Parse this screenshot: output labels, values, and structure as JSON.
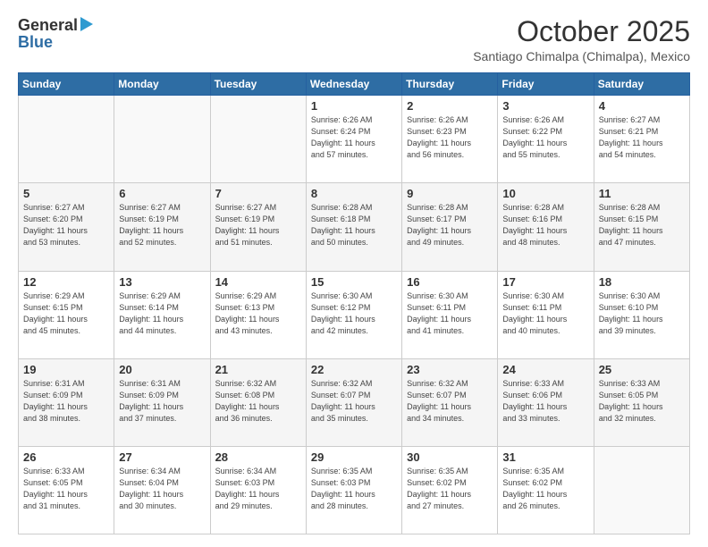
{
  "header": {
    "logo_general": "General",
    "logo_blue": "Blue",
    "month": "October 2025",
    "location": "Santiago Chimalpa (Chimalpa), Mexico"
  },
  "weekdays": [
    "Sunday",
    "Monday",
    "Tuesday",
    "Wednesday",
    "Thursday",
    "Friday",
    "Saturday"
  ],
  "weeks": [
    [
      {
        "day": "",
        "info": ""
      },
      {
        "day": "",
        "info": ""
      },
      {
        "day": "",
        "info": ""
      },
      {
        "day": "1",
        "info": "Sunrise: 6:26 AM\nSunset: 6:24 PM\nDaylight: 11 hours\nand 57 minutes."
      },
      {
        "day": "2",
        "info": "Sunrise: 6:26 AM\nSunset: 6:23 PM\nDaylight: 11 hours\nand 56 minutes."
      },
      {
        "day": "3",
        "info": "Sunrise: 6:26 AM\nSunset: 6:22 PM\nDaylight: 11 hours\nand 55 minutes."
      },
      {
        "day": "4",
        "info": "Sunrise: 6:27 AM\nSunset: 6:21 PM\nDaylight: 11 hours\nand 54 minutes."
      }
    ],
    [
      {
        "day": "5",
        "info": "Sunrise: 6:27 AM\nSunset: 6:20 PM\nDaylight: 11 hours\nand 53 minutes."
      },
      {
        "day": "6",
        "info": "Sunrise: 6:27 AM\nSunset: 6:19 PM\nDaylight: 11 hours\nand 52 minutes."
      },
      {
        "day": "7",
        "info": "Sunrise: 6:27 AM\nSunset: 6:19 PM\nDaylight: 11 hours\nand 51 minutes."
      },
      {
        "day": "8",
        "info": "Sunrise: 6:28 AM\nSunset: 6:18 PM\nDaylight: 11 hours\nand 50 minutes."
      },
      {
        "day": "9",
        "info": "Sunrise: 6:28 AM\nSunset: 6:17 PM\nDaylight: 11 hours\nand 49 minutes."
      },
      {
        "day": "10",
        "info": "Sunrise: 6:28 AM\nSunset: 6:16 PM\nDaylight: 11 hours\nand 48 minutes."
      },
      {
        "day": "11",
        "info": "Sunrise: 6:28 AM\nSunset: 6:15 PM\nDaylight: 11 hours\nand 47 minutes."
      }
    ],
    [
      {
        "day": "12",
        "info": "Sunrise: 6:29 AM\nSunset: 6:15 PM\nDaylight: 11 hours\nand 45 minutes."
      },
      {
        "day": "13",
        "info": "Sunrise: 6:29 AM\nSunset: 6:14 PM\nDaylight: 11 hours\nand 44 minutes."
      },
      {
        "day": "14",
        "info": "Sunrise: 6:29 AM\nSunset: 6:13 PM\nDaylight: 11 hours\nand 43 minutes."
      },
      {
        "day": "15",
        "info": "Sunrise: 6:30 AM\nSunset: 6:12 PM\nDaylight: 11 hours\nand 42 minutes."
      },
      {
        "day": "16",
        "info": "Sunrise: 6:30 AM\nSunset: 6:11 PM\nDaylight: 11 hours\nand 41 minutes."
      },
      {
        "day": "17",
        "info": "Sunrise: 6:30 AM\nSunset: 6:11 PM\nDaylight: 11 hours\nand 40 minutes."
      },
      {
        "day": "18",
        "info": "Sunrise: 6:30 AM\nSunset: 6:10 PM\nDaylight: 11 hours\nand 39 minutes."
      }
    ],
    [
      {
        "day": "19",
        "info": "Sunrise: 6:31 AM\nSunset: 6:09 PM\nDaylight: 11 hours\nand 38 minutes."
      },
      {
        "day": "20",
        "info": "Sunrise: 6:31 AM\nSunset: 6:09 PM\nDaylight: 11 hours\nand 37 minutes."
      },
      {
        "day": "21",
        "info": "Sunrise: 6:32 AM\nSunset: 6:08 PM\nDaylight: 11 hours\nand 36 minutes."
      },
      {
        "day": "22",
        "info": "Sunrise: 6:32 AM\nSunset: 6:07 PM\nDaylight: 11 hours\nand 35 minutes."
      },
      {
        "day": "23",
        "info": "Sunrise: 6:32 AM\nSunset: 6:07 PM\nDaylight: 11 hours\nand 34 minutes."
      },
      {
        "day": "24",
        "info": "Sunrise: 6:33 AM\nSunset: 6:06 PM\nDaylight: 11 hours\nand 33 minutes."
      },
      {
        "day": "25",
        "info": "Sunrise: 6:33 AM\nSunset: 6:05 PM\nDaylight: 11 hours\nand 32 minutes."
      }
    ],
    [
      {
        "day": "26",
        "info": "Sunrise: 6:33 AM\nSunset: 6:05 PM\nDaylight: 11 hours\nand 31 minutes."
      },
      {
        "day": "27",
        "info": "Sunrise: 6:34 AM\nSunset: 6:04 PM\nDaylight: 11 hours\nand 30 minutes."
      },
      {
        "day": "28",
        "info": "Sunrise: 6:34 AM\nSunset: 6:03 PM\nDaylight: 11 hours\nand 29 minutes."
      },
      {
        "day": "29",
        "info": "Sunrise: 6:35 AM\nSunset: 6:03 PM\nDaylight: 11 hours\nand 28 minutes."
      },
      {
        "day": "30",
        "info": "Sunrise: 6:35 AM\nSunset: 6:02 PM\nDaylight: 11 hours\nand 27 minutes."
      },
      {
        "day": "31",
        "info": "Sunrise: 6:35 AM\nSunset: 6:02 PM\nDaylight: 11 hours\nand 26 minutes."
      },
      {
        "day": "",
        "info": ""
      }
    ]
  ]
}
